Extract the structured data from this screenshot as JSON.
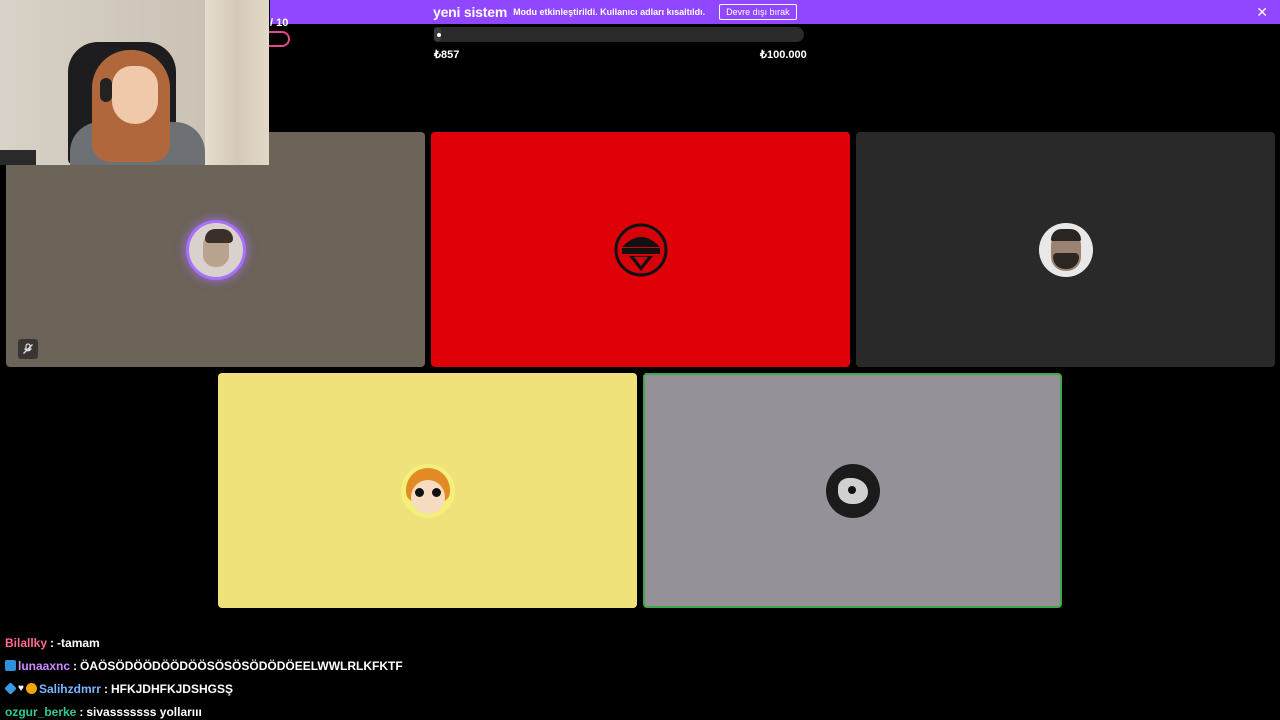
{
  "banner": {
    "brand": "yeni sistem",
    "message": "Modu etkinleştirildi. Kullanıcı adları kısaltıldı.",
    "button_label": "Devre dışı bırak",
    "close_glyph": "✕",
    "color": "#9147ff"
  },
  "counter": {
    "text": "/ 10"
  },
  "progress": {
    "min_label": "₺857",
    "max_label": "₺100.000",
    "value": 857,
    "max": 100000
  },
  "tiles": [
    {
      "color": "#6c6359",
      "avatar": "user-avatar-photo",
      "speaking": true,
      "muted": true
    },
    {
      "color": "#e00008",
      "avatar": "red-helmet-logo"
    },
    {
      "color": "#292929",
      "avatar": "bearded-man-photo"
    },
    {
      "color": "#efe27a",
      "avatar": "cartoon-girl"
    },
    {
      "color": "#969198",
      "avatar": "dark-cat-art",
      "active": true
    }
  ],
  "chat": [
    {
      "user": "Bilallky",
      "color": "#ff6b8a",
      "badges": [],
      "message": "-tamam"
    },
    {
      "user": "lunaaxnc",
      "color": "#c98cff",
      "badges": [
        "prime"
      ],
      "message": "ÖAÖSÖDÖÖDÖÖDÖÖSÖSÖSÖDÖDÖEELWWLRLKFKTF"
    },
    {
      "user": "Salihzdmrr",
      "color": "#7ab6ff",
      "badges": [
        "gem",
        "heart",
        "sub"
      ],
      "message": "HFKJDHFKJDSHGSŞ"
    },
    {
      "user": "ozgur_berke",
      "color": "#2ecc8f",
      "badges": [],
      "message": "sivasssssss yollarııı"
    }
  ],
  "separator": ":"
}
